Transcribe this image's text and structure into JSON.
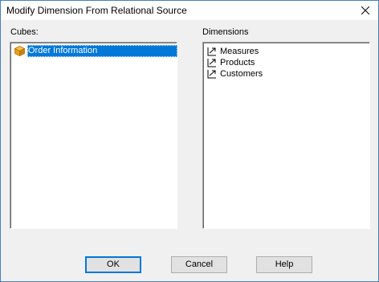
{
  "window": {
    "title": "Modify Dimension From Relational Source",
    "close_icon": "close-icon"
  },
  "cubes": {
    "label": "Cubes:",
    "items": [
      {
        "label": "Order Information",
        "icon": "cube-icon",
        "selected": true
      }
    ]
  },
  "dimensions": {
    "label": "Dimensions",
    "items": [
      {
        "label": "Measures",
        "icon": "dimension-icon"
      },
      {
        "label": "Products",
        "icon": "dimension-icon"
      },
      {
        "label": "Customers",
        "icon": "dimension-icon"
      }
    ]
  },
  "buttons": {
    "ok": "OK",
    "cancel": "Cancel",
    "help": "Help"
  },
  "colors": {
    "selection": "#0078d7",
    "cube_icon": "#e8a317",
    "dialog_bg": "#f0f0f0",
    "default_button_border": "#0078d7"
  }
}
